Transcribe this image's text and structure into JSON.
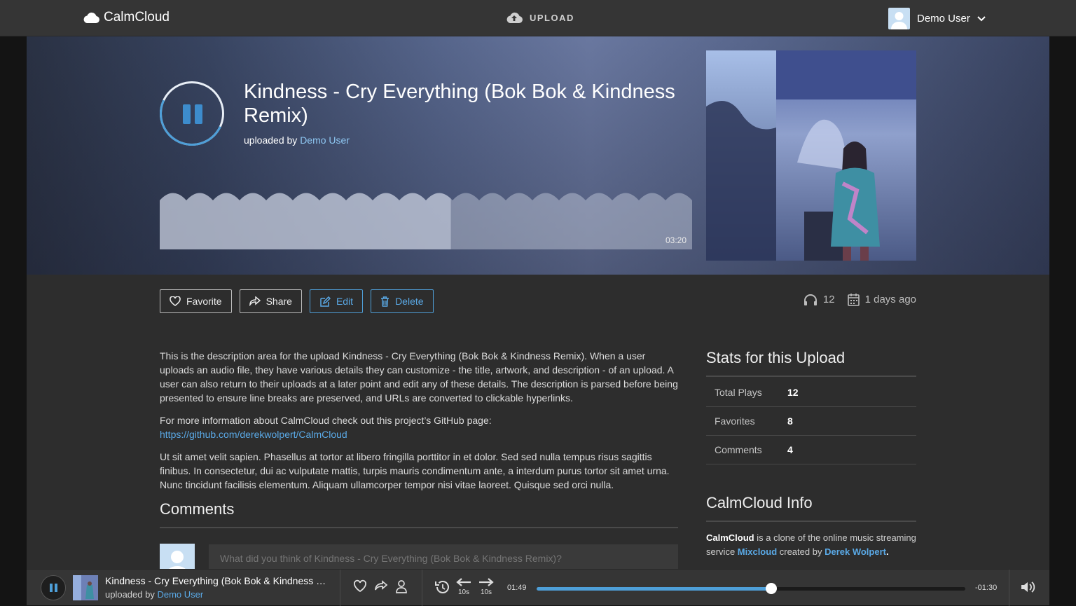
{
  "nav": {
    "brand": "CalmCloud",
    "upload_label": "UPLOAD",
    "user_name": "Demo User"
  },
  "track": {
    "title": "Kindness - Cry Everything (Bok Bok & Kindness Remix)",
    "uploaded_by_prefix": "uploaded by",
    "uploader": "Demo User",
    "duration": "03:20",
    "waveform_progress": 0.547
  },
  "actions": {
    "favorite": "Favorite",
    "share": "Share",
    "edit": "Edit",
    "delete": "Delete"
  },
  "meta": {
    "plays": "12",
    "age": "1 days ago"
  },
  "description": {
    "p1": "This is the description area for the upload Kindness - Cry Everything (Bok Bok & Kindness Remix). When a user uploads an audio file, they have various details they can customize - the title, artwork, and description - of an upload. A user can also return to their uploads at a later point and edit any of these details. The description is parsed before being presented to ensure line breaks are preserved, and URLs are converted to clickable hyperlinks.",
    "p2_prefix": "For more information about CalmCloud check out this project’s GitHub page:",
    "p2_link": "https://github.com/derekwolpert/CalmCloud",
    "p3": "Ut sit amet velit sapien. Phasellus at tortor at libero fringilla porttitor in et dolor. Sed sed nulla tempus risus sagittis finibus. In consectetur, dui ac vulputate mattis, turpis mauris condimentum ante, a interdum purus tortor sit amet urna. Nunc tincidunt facilisis elementum. Aliquam ullamcorper tempor nisi vitae laoreet. Quisque sed orci nulla."
  },
  "comments": {
    "heading": "Comments",
    "placeholder": "What did you think of Kindness - Cry Everything (Bok Bok & Kindness Remix)?"
  },
  "stats": {
    "heading": "Stats for this Upload",
    "rows": [
      {
        "label": "Total Plays",
        "value": "12"
      },
      {
        "label": "Favorites",
        "value": "8"
      },
      {
        "label": "Comments",
        "value": "4"
      }
    ]
  },
  "info": {
    "heading": "CalmCloud Info",
    "brand": "CalmCloud",
    "text1": " is a clone of the online music streaming service ",
    "link1": "Mixcloud",
    "text2": " created by ",
    "link2": "Derek Wolpert",
    "text3": "."
  },
  "player": {
    "title": "Kindness - Cry Everything (Bok Bok & Kindness Re...",
    "uploaded_by_prefix": "uploaded by",
    "uploader": "Demo User",
    "skip_back_label": "10s",
    "skip_fwd_label": "10s",
    "elapsed": "01:49",
    "remaining": "-01:30",
    "progress": 0.548
  },
  "colors": {
    "accent": "#4e9fd8",
    "link": "#5aa9e6",
    "nav_bg": "#353535",
    "page_bg": "#2d2d2d"
  }
}
